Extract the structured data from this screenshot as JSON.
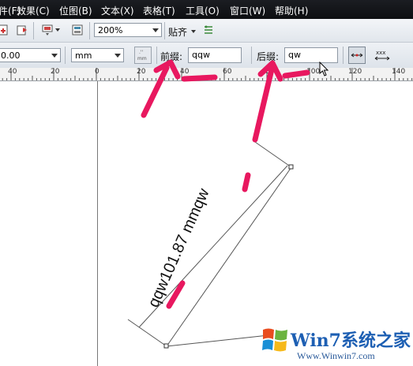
{
  "menu": [
    {
      "label": "件(F)"
    },
    {
      "label": "效果(C)"
    },
    {
      "label": "位图(B)"
    },
    {
      "label": "文本(X)"
    },
    {
      "label": "表格(T)"
    },
    {
      "label": "工具(O)"
    },
    {
      "label": "窗口(W)"
    },
    {
      "label": "帮助(H)"
    }
  ],
  "toolbar1": {
    "zoom_value": "200%",
    "snap_label": "贴齐"
  },
  "toolbar2": {
    "precision_value": "0.00",
    "units_value": "mm",
    "prefix_label": "前缀:",
    "prefix_value": "qqw",
    "suffix_label": "后缀:",
    "suffix_value": "qw"
  },
  "ruler": {
    "labels": [
      "40",
      "20",
      "0",
      "20",
      "40",
      "60",
      "80",
      "100",
      "120",
      "140"
    ]
  },
  "dimension": {
    "text": "qqw101.87 mmqw"
  },
  "watermark": {
    "brand_main": "Win7系统之家",
    "url": "Www.Winwin7.com"
  },
  "colors": {
    "annotation_accent": "#e8185f",
    "menubar_bg": "#111216"
  }
}
